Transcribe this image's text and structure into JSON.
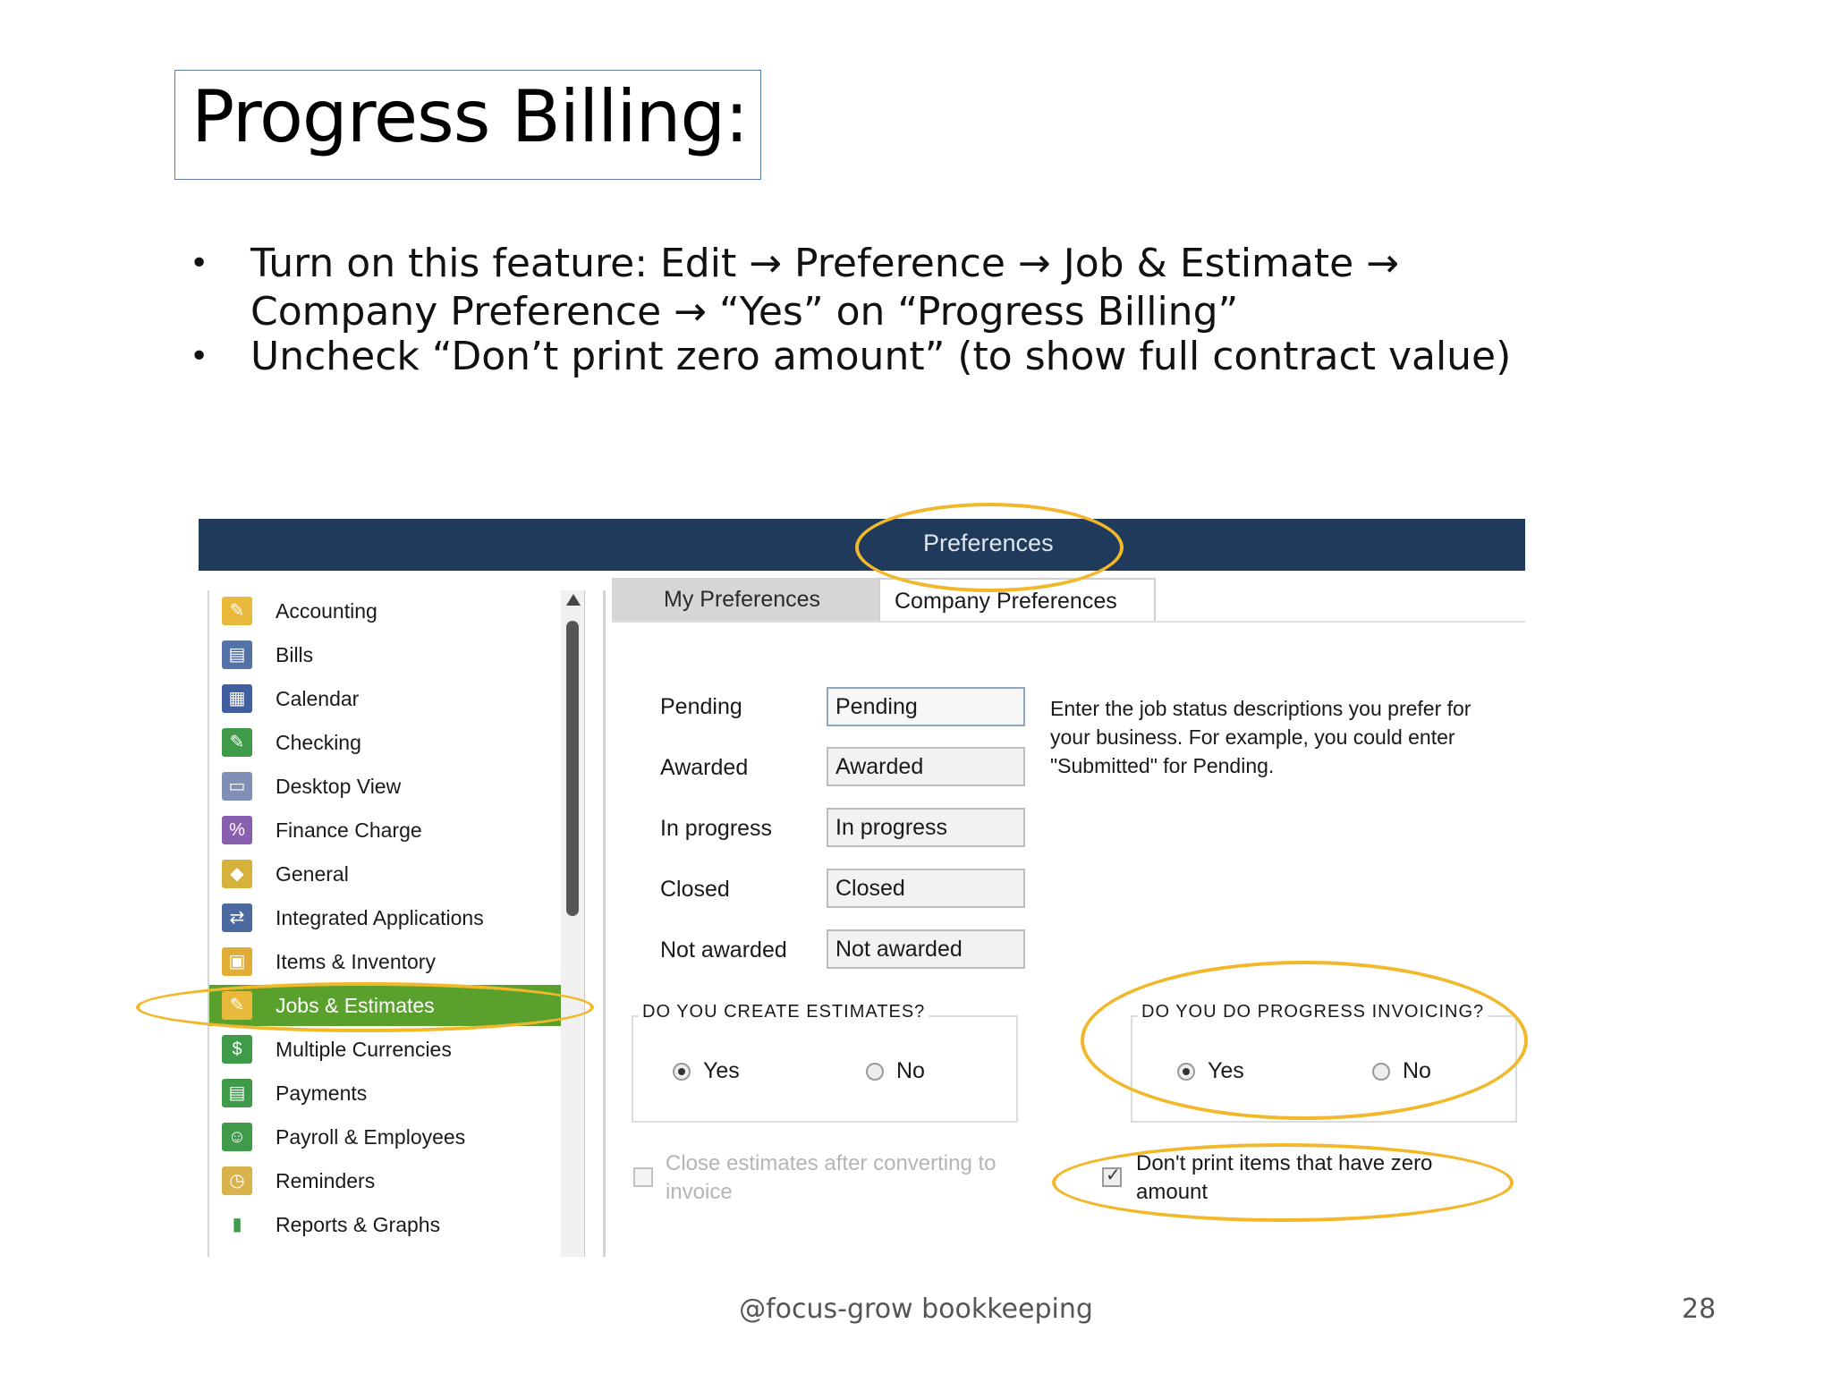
{
  "slide": {
    "title": "Progress Billing:",
    "bullets": [
      "Turn on this feature: Edit → Preference → Job & Estimate → Company Preference → “Yes” on “Progress Billing”",
      "Uncheck “Don’t print zero amount” (to show full contract value)"
    ],
    "footer": "@focus-grow bookkeeping",
    "page_number": "28"
  },
  "window": {
    "title": "Preferences",
    "accent_color": "#1f3a5a",
    "highlight_color": "#f0b82a",
    "selected_color": "#59a02d"
  },
  "sidebar": {
    "items": [
      {
        "label": "Accounting",
        "icon": "accounting-icon"
      },
      {
        "label": "Bills",
        "icon": "bills-icon"
      },
      {
        "label": "Calendar",
        "icon": "calendar-icon"
      },
      {
        "label": "Checking",
        "icon": "checking-icon"
      },
      {
        "label": "Desktop View",
        "icon": "desktop-view-icon"
      },
      {
        "label": "Finance Charge",
        "icon": "percent-icon"
      },
      {
        "label": "General",
        "icon": "general-icon"
      },
      {
        "label": "Integrated Applications",
        "icon": "integrated-apps-icon"
      },
      {
        "label": "Items & Inventory",
        "icon": "boxes-icon"
      },
      {
        "label": "Jobs & Estimates",
        "icon": "jobs-estimates-icon",
        "selected": true
      },
      {
        "label": "Multiple Currencies",
        "icon": "currencies-icon"
      },
      {
        "label": "Payments",
        "icon": "payments-icon"
      },
      {
        "label": "Payroll & Employees",
        "icon": "payroll-icon"
      },
      {
        "label": "Reminders",
        "icon": "alarm-clock-icon"
      },
      {
        "label": "Reports & Graphs",
        "icon": "bar-chart-icon"
      }
    ]
  },
  "tabs": {
    "my_preferences": "My Preferences",
    "company_preferences": "Company Preferences",
    "active": "Company Preferences"
  },
  "job_status": {
    "rows": [
      {
        "label": "Pending",
        "value": "Pending"
      },
      {
        "label": "Awarded",
        "value": "Awarded"
      },
      {
        "label": "In progress",
        "value": "In progress"
      },
      {
        "label": "Closed",
        "value": "Closed"
      },
      {
        "label": "Not awarded",
        "value": "Not awarded"
      }
    ],
    "help_text": "Enter the job status descriptions you prefer for your business.  For example, you could enter \"Submitted\" for Pending."
  },
  "estimates_group": {
    "title": "DO YOU CREATE ESTIMATES?",
    "yes": "Yes",
    "no": "No",
    "selected": "Yes"
  },
  "progress_group": {
    "title": "DO YOU DO PROGRESS INVOICING?",
    "yes": "Yes",
    "no": "No",
    "selected": "Yes"
  },
  "close_estimates_option": {
    "label": "Close estimates after converting to invoice",
    "checked": false,
    "enabled": false
  },
  "zero_amount_option": {
    "label": "Don't print items that have zero amount",
    "checked": true
  }
}
